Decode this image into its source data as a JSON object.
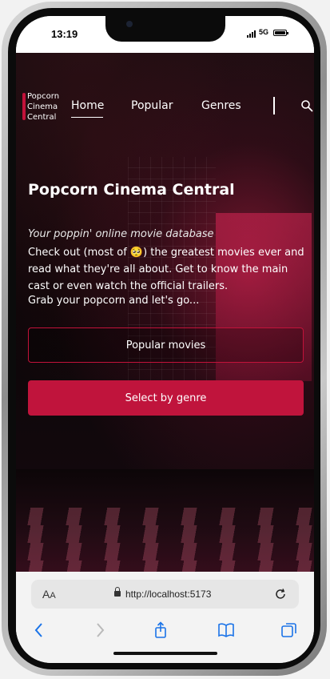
{
  "status_bar": {
    "time": "13:19",
    "network": "5G",
    "battery_level": 1.0
  },
  "site": {
    "brand": "Popcorn Cinema Central",
    "nav": {
      "home": "Home",
      "popular": "Popular",
      "genres": "Genres"
    },
    "hero": {
      "title": "Popcorn Cinema Central",
      "tagline": "Your poppin' online movie database",
      "description_pre": "Check out (most of ",
      "description_emoji": "🥺",
      "description_post": ") the greatest movies ever and read what they're all about. Get to know the main cast or even watch the official trailers.",
      "description_line2": "Grab your popcorn and let's go...",
      "popular_button": "Popular movies",
      "genre_button": "Select by genre"
    },
    "colors": {
      "accent": "#c0143c",
      "text": "#ffffff"
    }
  },
  "browser": {
    "text_size_label_big": "A",
    "text_size_label_small": "A",
    "url": "http://localhost:5173",
    "icons": [
      "back-icon",
      "forward-icon",
      "share-icon",
      "bookmarks-icon",
      "tabs-icon",
      "reload-icon",
      "lock-icon",
      "search-icon"
    ]
  }
}
